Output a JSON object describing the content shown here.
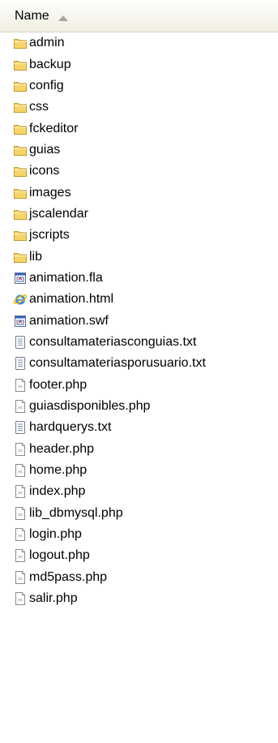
{
  "header": {
    "name_label": "Name",
    "sort": "ascending"
  },
  "items": [
    {
      "name": "admin",
      "icon": "folder-icon"
    },
    {
      "name": "backup",
      "icon": "folder-icon"
    },
    {
      "name": "config",
      "icon": "folder-icon"
    },
    {
      "name": "css",
      "icon": "folder-icon"
    },
    {
      "name": "fckeditor",
      "icon": "folder-icon"
    },
    {
      "name": "guias",
      "icon": "folder-icon"
    },
    {
      "name": "icons",
      "icon": "folder-icon"
    },
    {
      "name": "images",
      "icon": "folder-icon"
    },
    {
      "name": "jscalendar",
      "icon": "folder-icon"
    },
    {
      "name": "jscripts",
      "icon": "folder-icon"
    },
    {
      "name": "lib",
      "icon": "folder-icon"
    },
    {
      "name": "animation.fla",
      "icon": "flash-file-icon"
    },
    {
      "name": "animation.html",
      "icon": "ie-html-icon"
    },
    {
      "name": "animation.swf",
      "icon": "flash-file-icon"
    },
    {
      "name": "consultamateriasconguias.txt",
      "icon": "text-file-icon"
    },
    {
      "name": "consultamateriasporusuario.txt",
      "icon": "text-file-icon"
    },
    {
      "name": "footer.php",
      "icon": "php-file-icon"
    },
    {
      "name": "guiasdisponibles.php",
      "icon": "php-file-icon"
    },
    {
      "name": "hardquerys.txt",
      "icon": "text-file-icon"
    },
    {
      "name": "header.php",
      "icon": "php-file-icon"
    },
    {
      "name": "home.php",
      "icon": "php-file-icon"
    },
    {
      "name": "index.php",
      "icon": "php-file-icon"
    },
    {
      "name": "lib_dbmysql.php",
      "icon": "php-file-icon"
    },
    {
      "name": "login.php",
      "icon": "php-file-icon"
    },
    {
      "name": "logout.php",
      "icon": "php-file-icon"
    },
    {
      "name": "md5pass.php",
      "icon": "php-file-icon"
    },
    {
      "name": "salir.php",
      "icon": "php-file-icon"
    }
  ],
  "colors": {
    "folder": "#f5d56b",
    "folder_outline": "#c49a2b",
    "header_bg": "#f1efe2"
  }
}
